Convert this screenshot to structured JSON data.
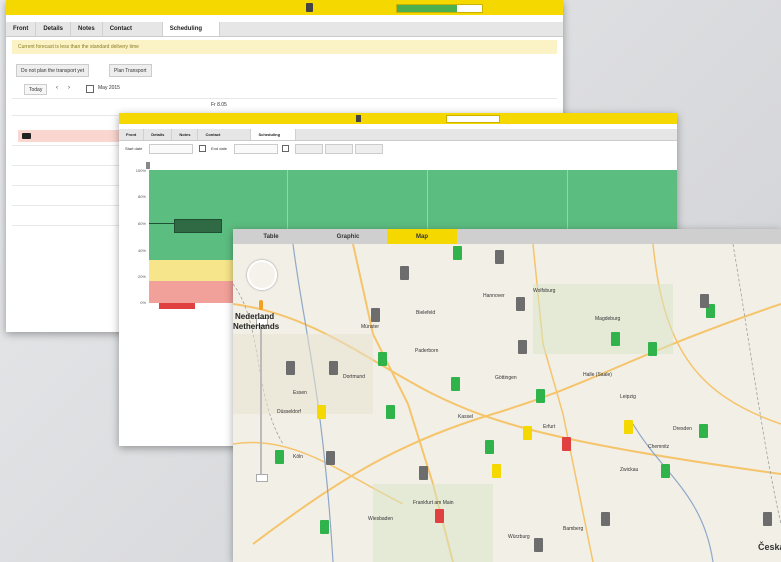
{
  "colors": {
    "yellow": "#f4d800",
    "green": "#5cbd80",
    "red": "#e04040",
    "gray": "#777777",
    "light_green": "#2fb34a"
  },
  "window1": {
    "tabs": [
      {
        "label": "Front"
      },
      {
        "label": "Details"
      },
      {
        "label": "Notes"
      },
      {
        "label": "Contact"
      },
      {
        "label": "Scheduling"
      }
    ],
    "notice": "Current forecast is less than the standard delivery time",
    "btn_do_not_plan": "Do not plan the transport yet",
    "btn_plan": "Plan Transport",
    "nav_today": "Today",
    "nav_month": "May 2015",
    "day_header": "Fr 8.05"
  },
  "window2": {
    "tabs": [
      {
        "label": "Front"
      },
      {
        "label": "Details"
      },
      {
        "label": "Notes"
      },
      {
        "label": "Contact"
      },
      {
        "label": "Scheduling"
      }
    ],
    "start_label": "Start date",
    "end_label": "End date",
    "y_labels": [
      "100%",
      "80%",
      "60%",
      "40%",
      "20%",
      "0%"
    ]
  },
  "window3": {
    "tabs": [
      {
        "label": "Table"
      },
      {
        "label": "Graphic"
      },
      {
        "label": "Map"
      }
    ],
    "map_labels": [
      {
        "text": "Nederland",
        "cls": "big"
      },
      {
        "text": "Netherlands",
        "cls": "big"
      },
      {
        "text": "Münster"
      },
      {
        "text": "Bielefeld"
      },
      {
        "text": "Paderborn"
      },
      {
        "text": "Dortmund"
      },
      {
        "text": "Essen"
      },
      {
        "text": "Düsseldorf"
      },
      {
        "text": "Köln"
      },
      {
        "text": "Kassel"
      },
      {
        "text": "Göttingen"
      },
      {
        "text": "Erfurt"
      },
      {
        "text": "Leipzig"
      },
      {
        "text": "Halle (Saale)"
      },
      {
        "text": "Dresden"
      },
      {
        "text": "Chemnitz"
      },
      {
        "text": "Zwickau"
      },
      {
        "text": "Frankfurt am Main"
      },
      {
        "text": "Wiesbaden"
      },
      {
        "text": "Würzburg"
      },
      {
        "text": "Bamberg"
      },
      {
        "text": "Magdeburg"
      },
      {
        "text": "Hannover"
      },
      {
        "text": "Wolfsburg"
      },
      {
        "text": "Česká"
      }
    ]
  }
}
